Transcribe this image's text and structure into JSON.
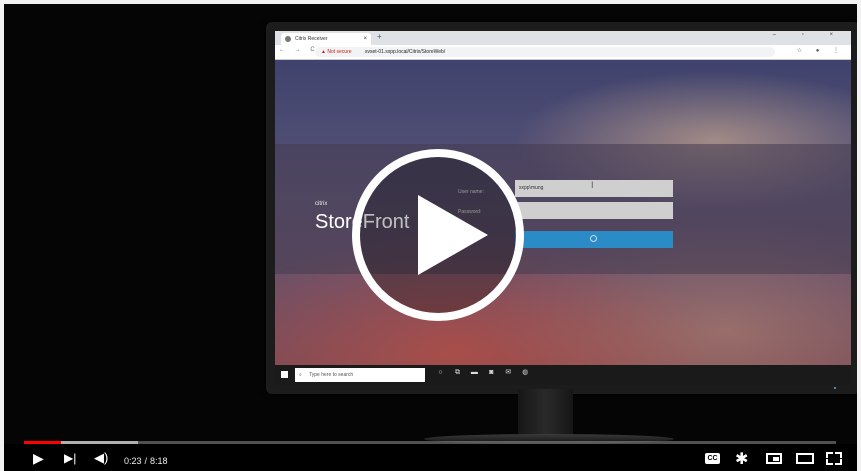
{
  "browser": {
    "tab_title": "Citrix Receiver",
    "tab_close": "×",
    "new_tab": "+",
    "window_controls": "–  ▫  ×",
    "nav": "← → C",
    "security_warning": "▲ Not secure",
    "url": "svset-01.sxpp.local/Citrix/StoreWeb/",
    "bar_icons": "☆ ● ⋮"
  },
  "storefront": {
    "brand_small": "citrix",
    "brand": "StoreFront",
    "username_label": "User name:",
    "password_label": "Password:",
    "username_value": "sxpp\\mung",
    "password_value": "",
    "caret": "I"
  },
  "taskbar": {
    "search_placeholder": "Type here to search",
    "icons": [
      "○",
      "⧉",
      "▬",
      "◙",
      "✉",
      "◍"
    ]
  },
  "player": {
    "current_time": "0:23",
    "separator": "/",
    "duration": "8:18",
    "played_fraction": 0.046,
    "buffered_fraction": 0.14,
    "cc_label": "CC",
    "colors": {
      "played": "#ff0000",
      "accent": "#2a8bc6"
    }
  }
}
